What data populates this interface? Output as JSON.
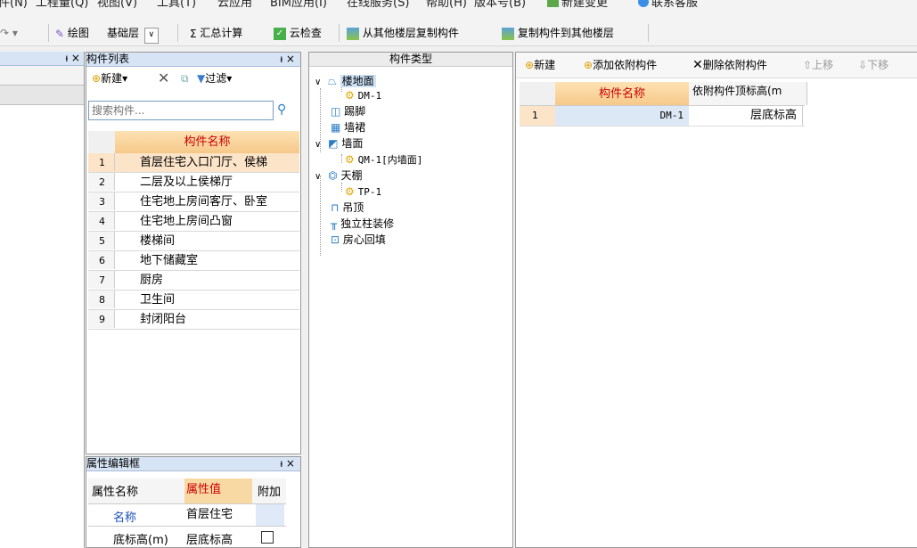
{
  "menu": [
    "件(N)",
    "工程量(Q)",
    "视图(V)",
    "工具(T)",
    "云应用",
    "BIM应用(I)",
    "在线服务(S)",
    "帮助(H)",
    "版本号(B)",
    "新建变更",
    "联系客服"
  ],
  "toolbar": {
    "draw": "绘图",
    "layer": "基础层",
    "summary": "汇总计算",
    "cloud_check": "云检查",
    "copy_from": "从其他楼层复制构件",
    "copy_to": "复制构件到其他楼层"
  },
  "left_panel": {
    "pin": "ᵼ ×"
  },
  "component_list": {
    "title": "构件列表",
    "pin": "ᵼ ×",
    "new_label": "新建",
    "filter_label": "过滤",
    "search_placeholder": "搜索构件...",
    "header": "构件名称",
    "rows": [
      {
        "num": "1",
        "name": "首层住宅入口门厅、侯梯"
      },
      {
        "num": "2",
        "name": "二层及以上侯梯厅"
      },
      {
        "num": "3",
        "name": "住宅地上房间客厅、卧室"
      },
      {
        "num": "4",
        "name": "住宅地上房间凸窗"
      },
      {
        "num": "5",
        "name": "楼梯间"
      },
      {
        "num": "6",
        "name": "地下储藏室"
      },
      {
        "num": "7",
        "name": "厨房"
      },
      {
        "num": "8",
        "name": "卫生间"
      },
      {
        "num": "9",
        "name": "封闭阳台"
      }
    ]
  },
  "property_editor": {
    "title": "属性编辑框",
    "pin": "ᵼ ×",
    "headers": [
      "属性名称",
      "属性值",
      "附加"
    ],
    "rows": [
      {
        "name": "名称",
        "value": "首层住宅"
      },
      {
        "name": "底标高(m)",
        "value": "层底标高"
      }
    ]
  },
  "type_tree": {
    "title": "构件类型",
    "nodes": [
      "楼地面",
      "DM-1",
      "踢脚",
      "墙裙",
      "墙面",
      "QM-1[内墙面]",
      "天棚",
      "TP-1",
      "吊顶",
      "独立柱装修",
      "房心回填"
    ]
  },
  "right_panel": {
    "buttons": [
      "新建",
      "添加依附构件",
      "删除依附构件",
      "上移",
      "下移"
    ],
    "headers": [
      "构件名称",
      "依附构件顶标高(m"
    ],
    "rows": [
      {
        "num": "1",
        "name": "DM-1",
        "value": "层底标高"
      }
    ]
  },
  "colors": {
    "header_fill": "#f9d9a3",
    "panel_title": "#d6e4f5",
    "selected_row": "#fce4c8",
    "accent_text": "#cc0000"
  }
}
